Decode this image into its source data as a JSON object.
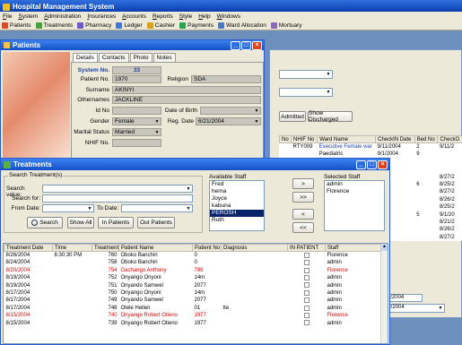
{
  "app": {
    "title": "Hospital Management System",
    "menu": [
      "File",
      "System",
      "Administration",
      "Insurances",
      "Accounts",
      "Reports",
      "Style",
      "Help",
      "Windows"
    ],
    "toolbar": [
      "Patients",
      "Treatments",
      "Pharmacy",
      "Ledger",
      "Cashier",
      "Payments",
      "Ward Allocation",
      "Mortuary"
    ]
  },
  "patients_window": {
    "title": "Patients",
    "tabs": [
      "Details",
      "Contacts",
      "Photo",
      "Notes"
    ],
    "labels": {
      "system_no": "System No.",
      "patient_no": "Patient No.",
      "religion": "Religion",
      "surname": "Surname",
      "othernames": "Othernames",
      "id_no": "Id No",
      "dob": "Date of Birth",
      "gender": "Gender",
      "reg_date": "Reg. Date",
      "marital": "Marital Status",
      "nhif": "NHIF No."
    },
    "values": {
      "system_no": "33",
      "patient_no": "1970",
      "religion": "SDA",
      "surname": "AKINYI",
      "othernames": "JACKLINE",
      "gender": "Female",
      "reg_date": "6/21/2004",
      "marital": "Married"
    }
  },
  "background_grid": {
    "admitted_btn": "Admitted",
    "discharged_btn": "Show Discharged",
    "headers": [
      "No",
      "NHIF No",
      "Ward Name",
      "CheckIN Date",
      "Bed No",
      "CheckO"
    ],
    "rows": [
      [
        "",
        "RTY009",
        "Executive Female war",
        "9/11/2004",
        "2",
        "9/11/2"
      ],
      [
        "",
        "",
        "Paediatric",
        "9/1/2004",
        "9",
        ""
      ],
      [
        "",
        "",
        "",
        "2004",
        "",
        ""
      ],
      [
        "",
        "",
        "",
        "004",
        "",
        ""
      ],
      [
        "",
        "",
        "",
        "2004",
        "",
        "8/27/2"
      ],
      [
        "",
        "",
        "",
        "2004",
        "6",
        "8/25/2"
      ],
      [
        "",
        "",
        "",
        "2004",
        "",
        "8/27/2"
      ],
      [
        "",
        "",
        "",
        "2004",
        "",
        "8/26/2"
      ],
      [
        "",
        "",
        "",
        "2004",
        "",
        "8/25/2"
      ],
      [
        "",
        "",
        "",
        "004",
        "5",
        "9/1/20"
      ],
      [
        "",
        "",
        "",
        "2004",
        "",
        "8/21/2"
      ],
      [
        "",
        "",
        "",
        "2004",
        "",
        "8/26/2"
      ],
      [
        "",
        "",
        "",
        "2004",
        "",
        "8/27/2"
      ]
    ],
    "side_date": "9/11/2004",
    "side_date2": "9/12/2004"
  },
  "treatments_window": {
    "title": "Treatments",
    "search_group": "Search Treatment(s)",
    "search_value_label": "Search value:",
    "search_for_label": "Search for:",
    "from_date_label": "From Date:",
    "to_date_label": "To Date:",
    "search_btn": "Search",
    "show_all_btn": "Show All",
    "in_patients_btn": "In Patients",
    "out_patients_btn": "Out Patients",
    "available_staff_label": "Available Staff",
    "selected_staff_label": "Selected Staff",
    "available_staff": [
      "Fred",
      "hema",
      "Joyce",
      "kabuna",
      "PEROSH",
      "Ruth"
    ],
    "selected_available": "PEROSH",
    "selected_staff": [
      "admin",
      "Florence"
    ],
    "move_buttons": [
      ">",
      ">>",
      "<",
      "<<"
    ],
    "columns": [
      "Treatment Date",
      "Time",
      "Treatment No",
      "Patient Name",
      "Patient No",
      "Diagnosis",
      "IN PATIENT",
      "Staff"
    ],
    "rows": [
      {
        "date": "8/26/2004",
        "time": "6:30:30 PM",
        "no": "760",
        "name": "Oboko Banchiri",
        "pno": "0",
        "diag": "",
        "staff": "Florence",
        "red": false
      },
      {
        "date": "8/24/2004",
        "time": "",
        "no": "758",
        "name": "Oboko Banchiri",
        "pno": "0",
        "diag": "",
        "staff": "admin",
        "red": false
      },
      {
        "date": "8/20/2004",
        "time": "",
        "no": "754",
        "name": "Gachango Anthony",
        "pno": "799",
        "diag": "",
        "staff": "Florence",
        "red": true
      },
      {
        "date": "8/19/2004",
        "time": "",
        "no": "752",
        "name": "Onyango Onyoni",
        "pno": "14m",
        "diag": "",
        "staff": "admin",
        "red": false
      },
      {
        "date": "8/19/2004",
        "time": "",
        "no": "751",
        "name": "Onyando Samwel",
        "pno": "2077",
        "diag": "",
        "staff": "admin",
        "red": false
      },
      {
        "date": "8/17/2004",
        "time": "",
        "no": "750",
        "name": "Onyango Onyoni",
        "pno": "14m",
        "diag": "",
        "staff": "admin",
        "red": false
      },
      {
        "date": "8/17/2004",
        "time": "",
        "no": "749",
        "name": "Onyando Samwel",
        "pno": "2077",
        "diag": "",
        "staff": "admin",
        "red": false
      },
      {
        "date": "8/17/2004",
        "time": "",
        "no": "748",
        "name": "Otele Hellen",
        "pno": "01",
        "diag": "tte",
        "staff": "admin",
        "red": false
      },
      {
        "date": "8/15/2004",
        "time": "",
        "no": "740",
        "name": "Onyango Robert Otieno",
        "pno": "1977",
        "diag": "",
        "staff": "Florence",
        "red": true
      },
      {
        "date": "8/15/2004",
        "time": "",
        "no": "739",
        "name": "Onyango Robert Otieno",
        "pno": "1977",
        "diag": "",
        "staff": "admin",
        "red": false
      }
    ]
  },
  "colors": {
    "title_blue": "#0a3fb0",
    "red_row": "#e00000",
    "selected_bg": "#0a246a"
  }
}
